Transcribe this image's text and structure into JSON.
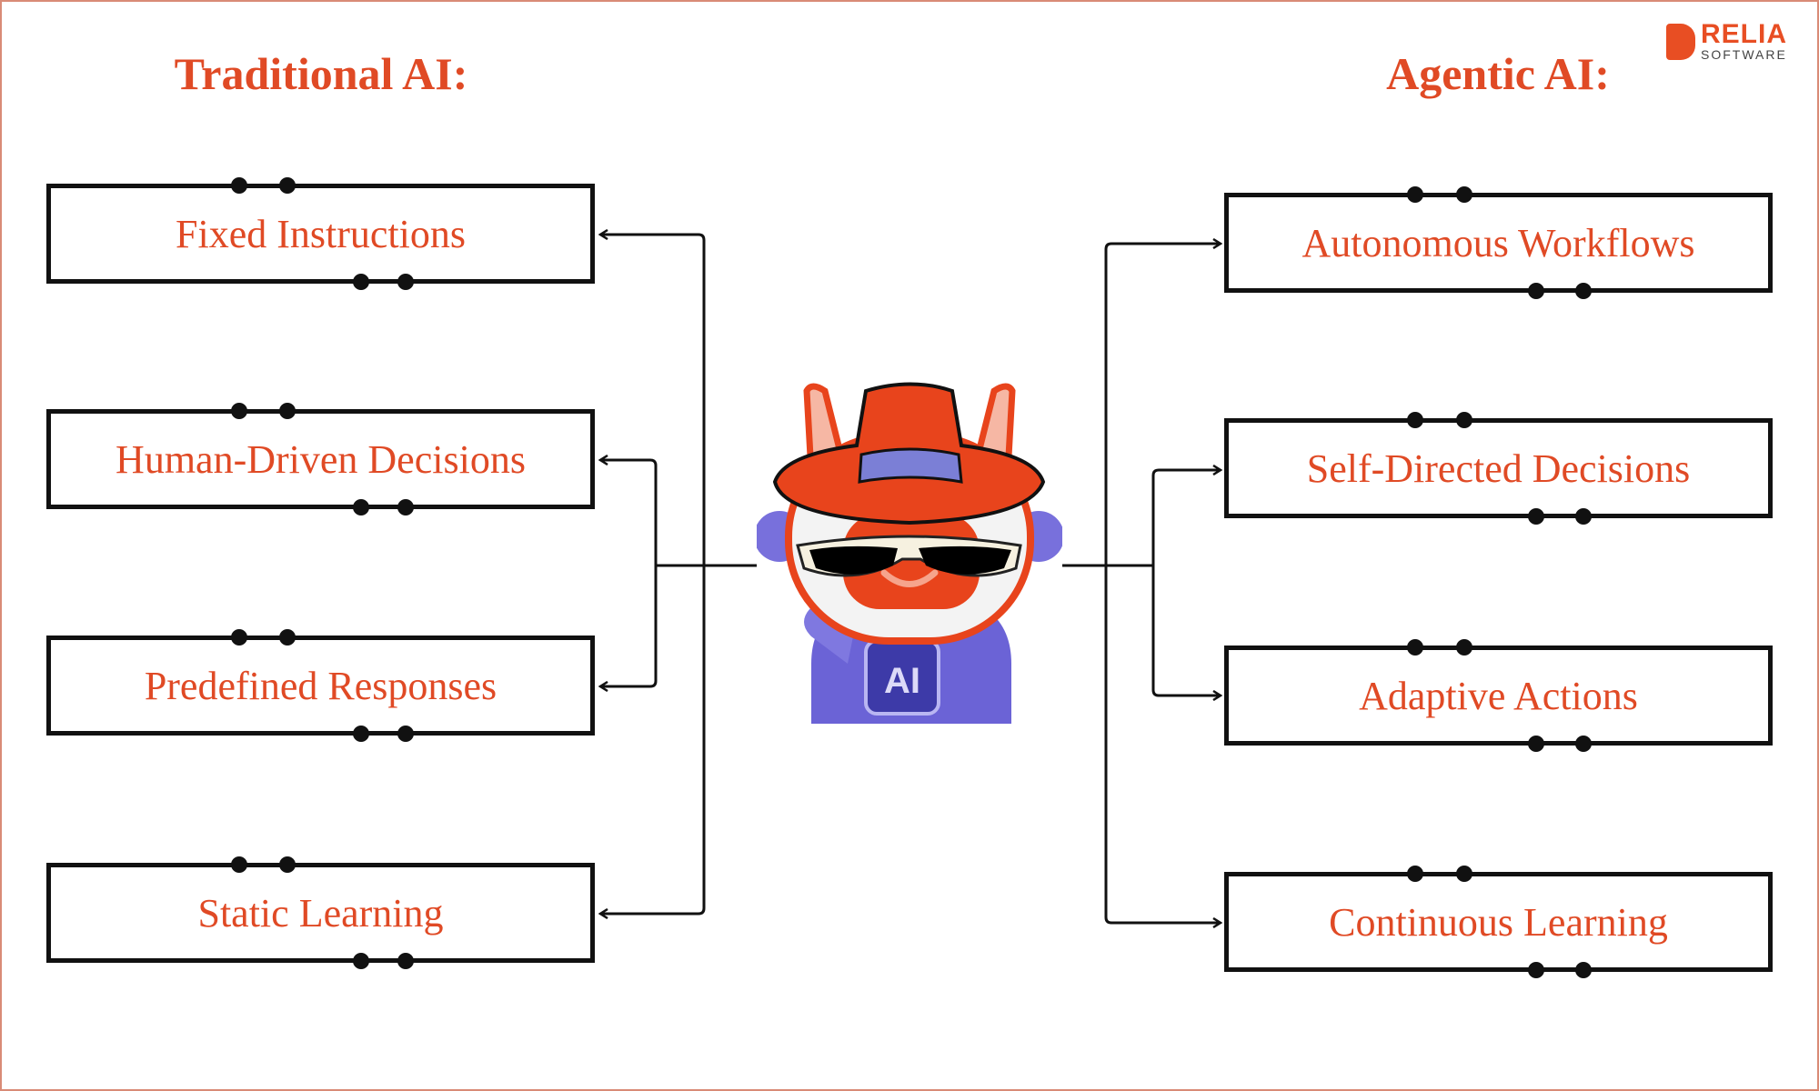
{
  "logo": {
    "name": "RELIA",
    "sub": "SOFTWARE"
  },
  "left": {
    "title": "Traditional AI:",
    "items": [
      "Fixed Instructions",
      "Human-Driven Decisions",
      "Predefined Responses",
      "Static Learning"
    ]
  },
  "right": {
    "title": "Agentic AI:",
    "items": [
      "Autonomous Workflows",
      "Self-Directed Decisions",
      "Adaptive Actions",
      "Continuous Learning"
    ]
  },
  "robot": {
    "chip_label": "AI"
  },
  "colors": {
    "accent": "#e04a25",
    "border": "#d98b77",
    "robot_body": "#6b63d6"
  }
}
